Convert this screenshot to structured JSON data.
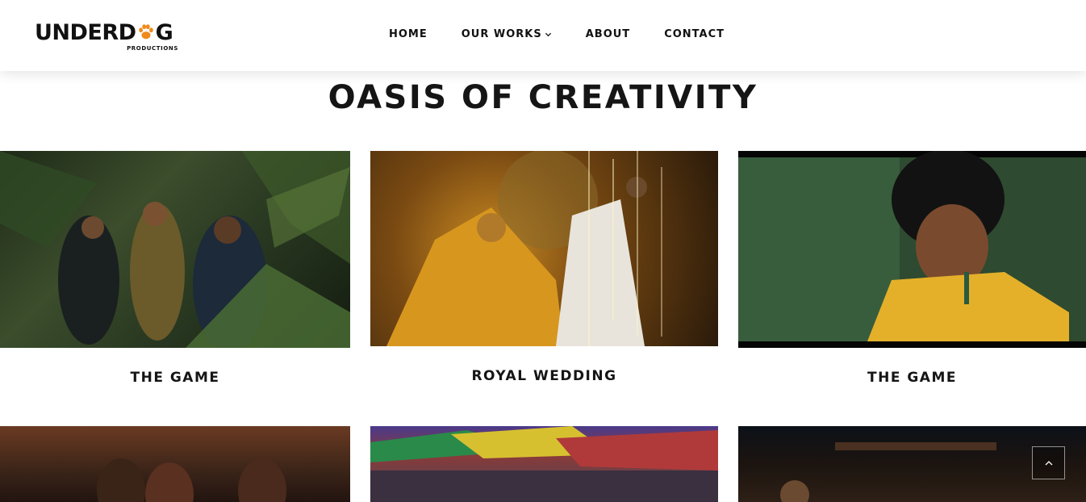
{
  "brand": {
    "name_left": "UNDERD",
    "name_right": "G",
    "tagline": "PRODUCTIONS",
    "accent_color": "#f08a1c"
  },
  "nav": {
    "items": [
      {
        "label": "HOME"
      },
      {
        "label": "OUR WORKS",
        "has_dropdown": true
      },
      {
        "label": "ABOUT"
      },
      {
        "label": "CONTACT"
      }
    ]
  },
  "section": {
    "title": "OASIS OF CREATIVITY"
  },
  "works": [
    {
      "title": "THE GAME"
    },
    {
      "title": "ROYAL WEDDING"
    },
    {
      "title": "THE GAME"
    }
  ],
  "icons": {
    "logo_paw": "paw-icon",
    "dropdown": "chevron-down-icon",
    "back_to_top": "chevron-up-icon"
  }
}
